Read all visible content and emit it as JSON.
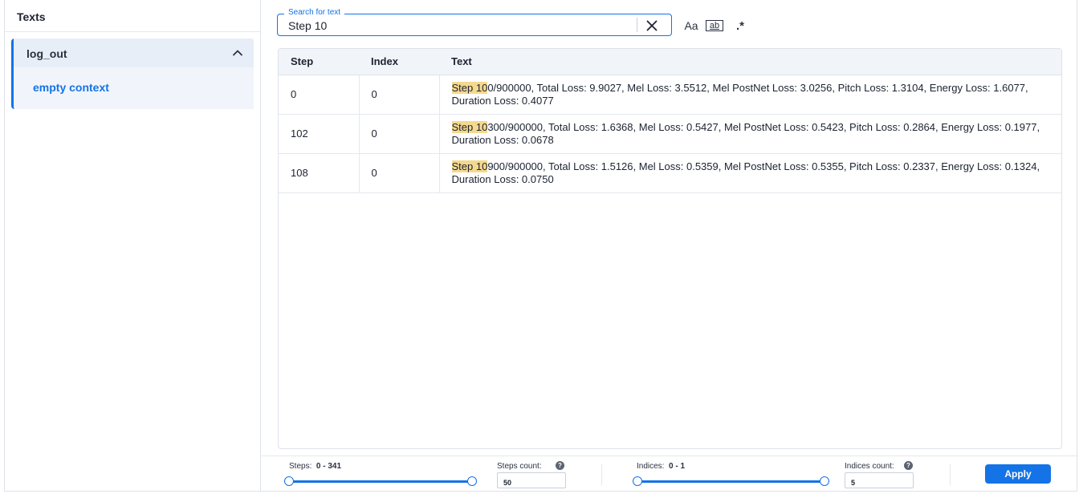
{
  "sidebar": {
    "title": "Texts",
    "group": {
      "label": "log_out",
      "item": "empty context"
    }
  },
  "search": {
    "legend": "Search for text",
    "value": "Step 10",
    "options": {
      "match_case": "Aa",
      "match_word": "ab",
      "regex": ".*"
    }
  },
  "table": {
    "columns": [
      "Step",
      "Index",
      "Text"
    ],
    "rows": [
      {
        "step": "0",
        "index": "0",
        "highlight": "Step 10",
        "text": "0/900000, Total Loss: 9.9027, Mel Loss: 3.5512, Mel PostNet Loss: 3.0256, Pitch Loss: 1.3104, Energy Loss: 1.6077, Duration Loss: 0.4077"
      },
      {
        "step": "102",
        "index": "0",
        "highlight": "Step 10",
        "text": "300/900000, Total Loss: 1.6368, Mel Loss: 0.5427, Mel PostNet Loss: 0.5423, Pitch Loss: 0.2864, Energy Loss: 0.1977, Duration Loss: 0.0678"
      },
      {
        "step": "108",
        "index": "0",
        "highlight": "Step 10",
        "text": "900/900000, Total Loss: 1.5126, Mel Loss: 0.5359, Mel PostNet Loss: 0.5355, Pitch Loss: 0.2337, Energy Loss: 0.1324, Duration Loss: 0.0750"
      }
    ]
  },
  "footer": {
    "steps_label": "Steps:",
    "steps_range": "0 - 341",
    "steps_count_label": "Steps count:",
    "steps_count_value": "50",
    "indices_label": "Indices:",
    "indices_range": "0 - 1",
    "indices_count_label": "Indices count:",
    "indices_count_value": "5",
    "help_glyph": "?",
    "apply_label": "Apply"
  },
  "colors": {
    "accent": "#1473e6",
    "highlight": "#f4d98e"
  },
  "icons": {
    "collapse": "chevron-up-icon",
    "clear": "close-icon"
  }
}
